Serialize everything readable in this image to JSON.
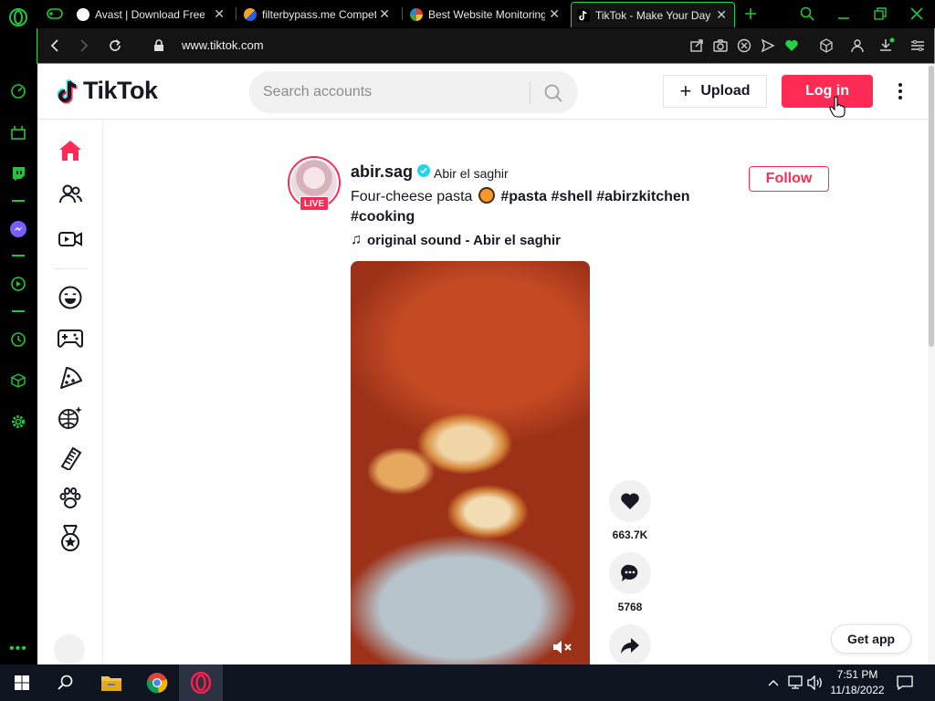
{
  "browser": {
    "tabs": [
      {
        "title": "Avast | Download Free A",
        "favicon_color": "#ffffff"
      },
      {
        "title": "filterbypass.me Compet",
        "favicon_color": "#f5a623"
      },
      {
        "title": "Best Website Monitoring",
        "favicon_color": "#4caf50"
      },
      {
        "title": "TikTok - Make Your Day",
        "favicon_color": "#000000",
        "active": true
      }
    ],
    "url": "www.tiktok.com",
    "accent_color": "#24d048"
  },
  "tiktok": {
    "logo_text": "TikTok",
    "search_placeholder": "Search accounts",
    "upload_label": "Upload",
    "login_label": "Log in",
    "brand_color": "#fe2c55",
    "post": {
      "username": "abir.sag",
      "nickname": "Abir el saghir",
      "live_label": "LIVE",
      "follow_label": "Follow",
      "caption_text": "Four-cheese pasta",
      "tags": [
        "#pasta",
        "#shell",
        "#abirzkitchen",
        "#cooking"
      ],
      "sound": "original sound - Abir el saghir",
      "like_count": "663.7K",
      "comment_count": "5768"
    },
    "get_app_label": "Get app"
  },
  "taskbar": {
    "time": "7:51 PM",
    "date": "11/18/2022"
  }
}
